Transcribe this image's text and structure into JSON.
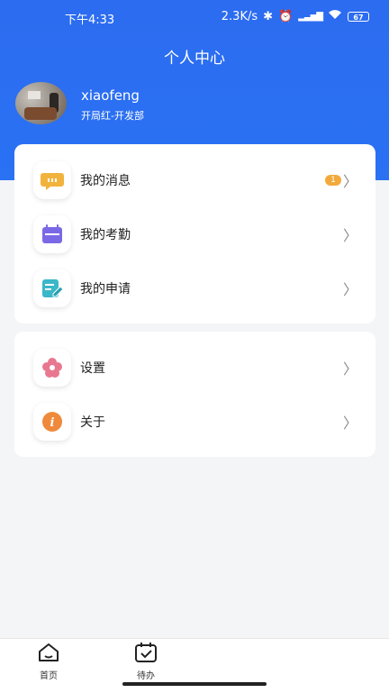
{
  "status_bar": {
    "time": "下午4:33",
    "speed": "2.3K/s",
    "battery": "67"
  },
  "header": {
    "title": "个人中心",
    "username": "xiaofeng",
    "department": "开局红-开发部"
  },
  "menu_group1": [
    {
      "label": "我的消息",
      "icon": "message-icon",
      "badge": "1"
    },
    {
      "label": "我的考勤",
      "icon": "calendar-icon"
    },
    {
      "label": "我的申请",
      "icon": "edit-doc-icon"
    }
  ],
  "menu_group2": [
    {
      "label": "设置",
      "icon": "flower-settings-icon"
    },
    {
      "label": "关于",
      "icon": "info-icon"
    }
  ],
  "tabbar": {
    "home": "首页",
    "todo": "待办"
  },
  "colors": {
    "header_blue": "#2c6cf0",
    "badge_orange": "#f3a93b"
  }
}
